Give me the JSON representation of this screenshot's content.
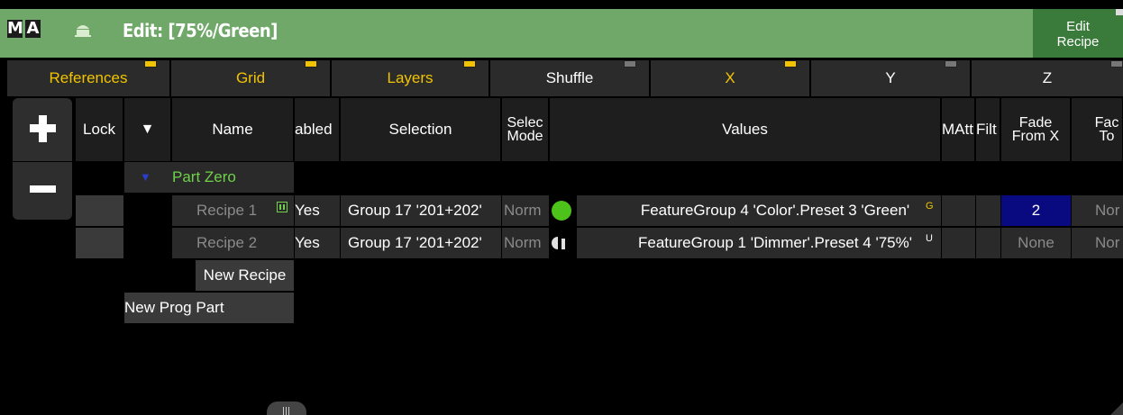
{
  "titlebar": {
    "logo_m": "M",
    "logo_a": "A",
    "title": "Edit: [75%/Green]",
    "edit_recipe": "Edit Recipe"
  },
  "tabs": [
    {
      "label": "References",
      "active": true
    },
    {
      "label": "Grid",
      "active": true
    },
    {
      "label": "Layers",
      "active": true
    },
    {
      "label": "Shuffle",
      "active": false
    },
    {
      "label": "X",
      "active": true
    },
    {
      "label": "Y",
      "active": false
    },
    {
      "label": "Z",
      "active": false
    }
  ],
  "headers": {
    "lock": "Lock",
    "sort": "▼",
    "name": "Name",
    "enabled": "abled",
    "selection": "Selection",
    "select_mode": "Selec Mode",
    "values": "Values",
    "matt": "MAtt",
    "filt": "Filt",
    "fade_from": "Fade From X",
    "fade_to": "Fac To"
  },
  "part": {
    "arrow": "▼",
    "name": "Part Zero"
  },
  "rows": [
    {
      "name": "Recipe 1",
      "enabled": "Yes",
      "selection": "Group 17 '201+202'",
      "mode": "Norm",
      "values": "FeatureGroup 4 'Color'.Preset 3 'Green'",
      "value_tag": "G",
      "fade_from": "2",
      "fade_to": "Nor"
    },
    {
      "name": "Recipe 2",
      "enabled": "Yes",
      "selection": "Group 17 '201+202'",
      "mode": "Norm",
      "values": "FeatureGroup 1 'Dimmer'.Preset 4 '75%'",
      "value_tag": "U",
      "fade_from": "None",
      "fade_to": "Nor"
    }
  ],
  "new_recipe": "New Recipe",
  "new_prog_part": "New Prog Part",
  "colors": {
    "titlebar": "#70a86a",
    "edit_recipe_btn": "#3a7a3a",
    "active_tab_text": "#f2c400",
    "part_text": "#6fd24a",
    "selected_cell": "#0a0a80"
  }
}
